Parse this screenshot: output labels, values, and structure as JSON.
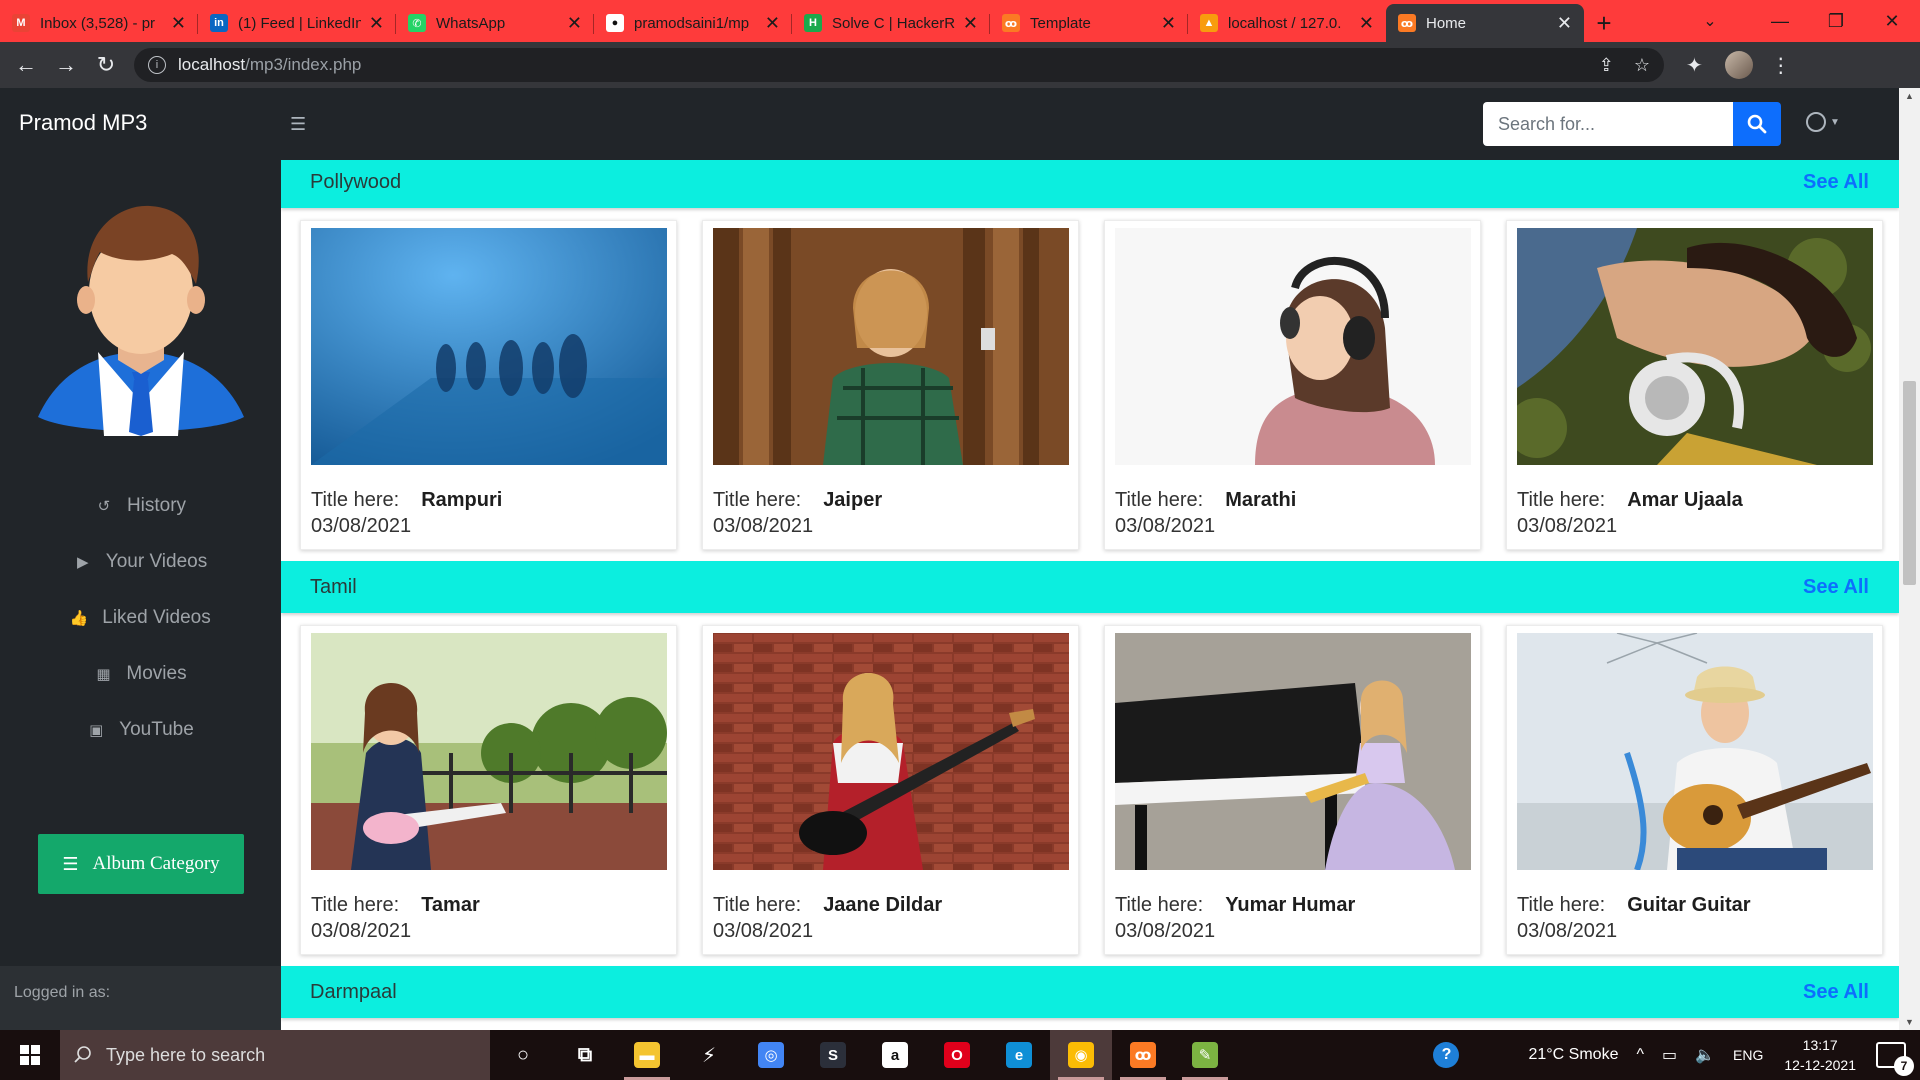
{
  "browser": {
    "tabs": [
      {
        "title": "Inbox (3,528) - pr",
        "icon": "gmail-icon",
        "color": "#ea4335",
        "glyph": "M",
        "active": false
      },
      {
        "title": "(1) Feed | LinkedIn",
        "icon": "linkedin-icon",
        "color": "#0a66c2",
        "glyph": "in",
        "active": false
      },
      {
        "title": "WhatsApp",
        "icon": "whatsapp-icon",
        "color": "#25d366",
        "glyph": "✆",
        "active": false
      },
      {
        "title": "pramodsaini1/mp",
        "icon": "github-icon",
        "color": "#ffffff",
        "glyph": "●",
        "active": false
      },
      {
        "title": "Solve C | HackerR",
        "icon": "hackerrank-icon",
        "color": "#1ba94c",
        "glyph": "H",
        "active": false
      },
      {
        "title": "Template",
        "icon": "xampp-icon",
        "color": "#fb7a24",
        "glyph": "ꝏ",
        "active": false
      },
      {
        "title": "localhost / 127.0.",
        "icon": "phpmyadmin-icon",
        "color": "#f89c0e",
        "glyph": "▲",
        "active": false
      },
      {
        "title": "Home",
        "icon": "xampp-icon",
        "color": "#fb7a24",
        "glyph": "ꝏ",
        "active": true
      }
    ],
    "url_host": "localhost",
    "url_path": "/mp3/index.php"
  },
  "nav": {
    "brand": "Pramod MP3",
    "search_placeholder": "Search for..."
  },
  "sidebar": {
    "menu": [
      {
        "label": "History",
        "icon": "history-icon",
        "glyph": "↺"
      },
      {
        "label": "Your Videos",
        "icon": "play-circle-icon",
        "glyph": "▶"
      },
      {
        "label": "Liked Videos",
        "icon": "thumbs-up-icon",
        "glyph": "👍"
      },
      {
        "label": "Movies",
        "icon": "film-icon",
        "glyph": "▦"
      },
      {
        "label": "YouTube",
        "icon": "youtube-icon",
        "glyph": "▣"
      }
    ],
    "album_button": "Album Category",
    "logged_in_label": "Logged in as:"
  },
  "categories": [
    {
      "name": "Pollywood",
      "see_all": "See All",
      "items": [
        {
          "label": "Title here:",
          "title": "Rampuri",
          "date": "03/08/2021",
          "thumb": "cyclists-fog"
        },
        {
          "label": "Title here:",
          "title": "Jaiper",
          "date": "03/08/2021",
          "thumb": "girl-headphones-wood"
        },
        {
          "label": "Title here:",
          "title": "Marathi",
          "date": "03/08/2021",
          "thumb": "woman-headphones-white"
        },
        {
          "label": "Title here:",
          "title": "Amar Ujaala",
          "date": "03/08/2021",
          "thumb": "woman-lying-headphones"
        }
      ]
    },
    {
      "name": "Tamil",
      "see_all": "See All",
      "items": [
        {
          "label": "Title here:",
          "title": "Tamar",
          "date": "03/08/2021",
          "thumb": "girl-toy-guitar"
        },
        {
          "label": "Title here:",
          "title": "Jaane Dildar",
          "date": "03/08/2021",
          "thumb": "girl-bass-brickwall"
        },
        {
          "label": "Title here:",
          "title": "Yumar Humar",
          "date": "03/08/2021",
          "thumb": "woman-piano"
        },
        {
          "label": "Title here:",
          "title": "Guitar Guitar",
          "date": "03/08/2021",
          "thumb": "man-acoustic-guitar"
        }
      ]
    },
    {
      "name": "Darmpaal",
      "see_all": "See All",
      "items": []
    }
  ],
  "taskbar": {
    "search_placeholder": "Type here to search",
    "weather": "21°C  Smoke",
    "lang": "ENG",
    "time": "13:17",
    "date": "12-12-2021",
    "notifications": "7",
    "apps": [
      {
        "name": "cortana-icon",
        "glyph": "○",
        "color": "transparent",
        "running": false,
        "active": false
      },
      {
        "name": "task-view-icon",
        "glyph": "⧉",
        "color": "transparent",
        "running": false,
        "active": false
      },
      {
        "name": "file-explorer-icon",
        "glyph": "▬",
        "color": "#f4c430",
        "running": true,
        "active": false
      },
      {
        "name": "sublime-icon",
        "glyph": "⚡",
        "color": "transparent",
        "running": false,
        "active": false
      },
      {
        "name": "chromium-icon",
        "glyph": "◎",
        "color": "#4285f4",
        "running": false,
        "active": false
      },
      {
        "name": "sublime-text-icon",
        "glyph": "S",
        "color": "#2b2f3a",
        "running": false,
        "active": false
      },
      {
        "name": "amazon-icon",
        "glyph": "a",
        "color": "#ffffff",
        "running": false,
        "active": false
      },
      {
        "name": "opera-icon",
        "glyph": "O",
        "color": "#e0001b",
        "running": false,
        "active": false
      },
      {
        "name": "edge-icon",
        "glyph": "e",
        "color": "#0f8fd6",
        "running": false,
        "active": false
      },
      {
        "name": "chrome-icon",
        "glyph": "◉",
        "color": "#fbbc05",
        "running": true,
        "active": true
      },
      {
        "name": "xampp-icon",
        "glyph": "ꝏ",
        "color": "#fb7a24",
        "running": true,
        "active": false
      },
      {
        "name": "notepad-icon",
        "glyph": "✎",
        "color": "#7cb342",
        "running": true,
        "active": false
      }
    ]
  },
  "colors": {
    "category_bar": "#0ceedf",
    "see_all": "#0d6efd",
    "album_button": "#14a86b",
    "sidebar": "#212529",
    "tabbar": "#fe3b3b"
  }
}
